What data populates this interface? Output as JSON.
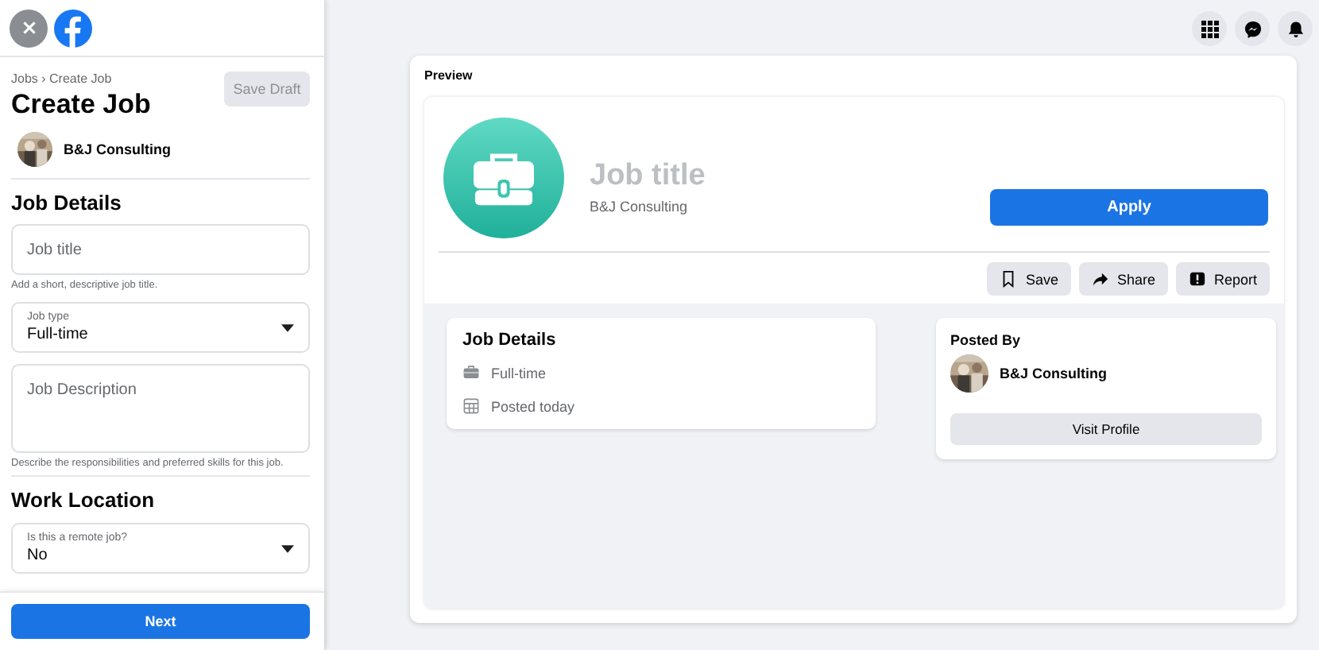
{
  "sidebar": {
    "breadcrumb": "Jobs › Create Job",
    "title": "Create Job",
    "save_draft": {
      "label": "Save Draft",
      "disabled": true
    },
    "page": {
      "name": "B&J Consulting"
    },
    "sections": [
      {
        "heading": "Job Details",
        "fields": [
          {
            "kind": "text",
            "placeholder": "Job title",
            "hint": "Add a short, descriptive job title."
          },
          {
            "kind": "select",
            "label": "Job type",
            "value": "Full-time"
          },
          {
            "kind": "textarea",
            "placeholder": "Job Description",
            "hint": "Describe the responsibilities and preferred skills for this job."
          }
        ]
      },
      {
        "heading": "Work Location",
        "fields": [
          {
            "kind": "select",
            "label": "Is this a remote job?",
            "value": "No"
          }
        ]
      }
    ],
    "next": {
      "label": "Next"
    }
  },
  "preview": {
    "heading": "Preview",
    "job_title": "Job title",
    "company": "B&J Consulting",
    "apply": "Apply",
    "actions": [
      {
        "kind": "save",
        "label": "Save"
      },
      {
        "kind": "share",
        "label": "Share"
      },
      {
        "kind": "report",
        "label": "Report"
      }
    ],
    "details": {
      "heading": "Job Details",
      "items": [
        {
          "kind": "type",
          "text": "Full-time"
        },
        {
          "kind": "date",
          "text": "Posted today"
        }
      ]
    },
    "posted_by": {
      "heading": "Posted By",
      "name": "B&J Consulting",
      "button": "Visit Profile"
    }
  }
}
